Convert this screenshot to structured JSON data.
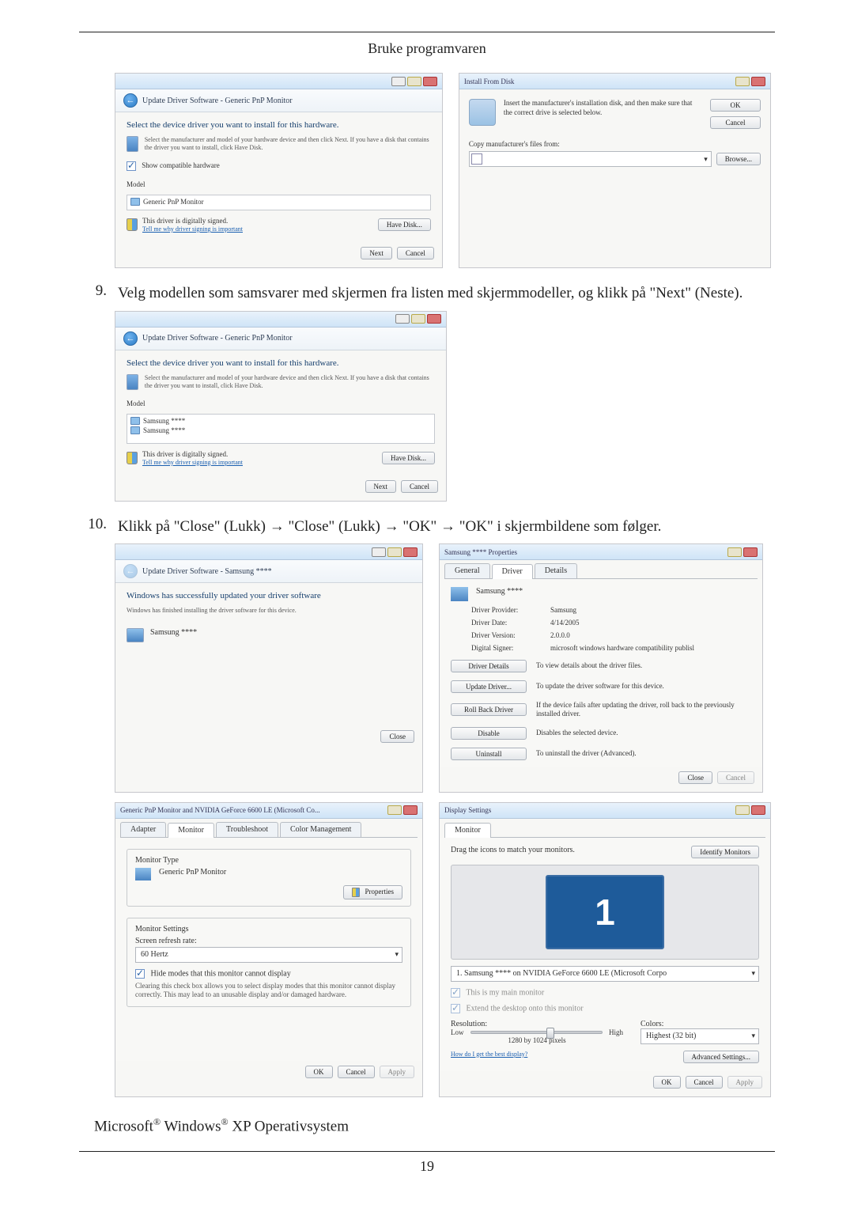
{
  "doc": {
    "running_head": "Bruke programvaren",
    "page_number": "19",
    "os_line_prefix": "Microsoft",
    "os_line_mid": " Windows",
    "os_line_suffix": " XP Operativsystem",
    "reg": "®"
  },
  "steps": {
    "num9": "9.",
    "text9": "Velg modellen som samsvarer med skjermen fra listen med skjermmodeller, og klikk på \"Next\" (Neste).",
    "num10": "10.",
    "text10": "Klikk på \"Close\" (Lukk) → \"Close\" (Lukk) → \"OK\" → \"OK\" i skjermbildene som følger."
  },
  "update_driver": {
    "crumb": "Update Driver Software - Generic PnP Monitor",
    "heading": "Select the device driver you want to install for this hardware.",
    "desc": "Select the manufacturer and model of your hardware device and then click Next. If you have a disk that contains the driver you want to install, click Have Disk.",
    "compat_check": "Show compatible hardware",
    "list_label": "Model",
    "item1": "Generic PnP Monitor",
    "sign_line": "This driver is digitally signed.",
    "sign_link": "Tell me why driver signing is important",
    "have_disk": "Have Disk...",
    "next": "Next",
    "cancel": "Cancel"
  },
  "install_from_disk": {
    "title": "Install From Disk",
    "text": "Insert the manufacturer's installation disk, and then make sure that the correct drive is selected below.",
    "ok": "OK",
    "cancel": "Cancel",
    "copy_label": "Copy manufacturer's files from:",
    "dropdown_caret": "▾",
    "browse": "Browse..."
  },
  "update_driver2": {
    "crumb": "Update Driver Software - Generic PnP Monitor",
    "item_a": "Samsung ****",
    "item_b": "Samsung ****"
  },
  "update_success": {
    "crumb": "Update Driver Software - Samsung ****",
    "heading": "Windows has successfully updated your driver software",
    "subhead": "Windows has finished installing the driver software for this device.",
    "model": "Samsung ****",
    "close": "Close"
  },
  "driver_props": {
    "title": "Samsung **** Properties",
    "tab_general": "General",
    "tab_driver": "Driver",
    "tab_details": "Details",
    "model": "Samsung ****",
    "provider_lbl": "Driver Provider:",
    "provider_val": "Samsung",
    "date_lbl": "Driver Date:",
    "date_val": "4/14/2005",
    "version_lbl": "Driver Version:",
    "version_val": "2.0.0.0",
    "signer_lbl": "Digital Signer:",
    "signer_val": "microsoft windows hardware compatibility publisl",
    "btn_details": "Driver Details",
    "btn_details_desc": "To view details about the driver files.",
    "btn_update": "Update Driver...",
    "btn_update_desc": "To update the driver software for this device.",
    "btn_rollback": "Roll Back Driver",
    "btn_rollback_desc": "If the device fails after updating the driver, roll back to the previously installed driver.",
    "btn_disable": "Disable",
    "btn_disable_desc": "Disables the selected device.",
    "btn_uninstall": "Uninstall",
    "btn_uninstall_desc": "To uninstall the driver (Advanced).",
    "close": "Close",
    "cancel": "Cancel"
  },
  "monitor_adapter": {
    "title": "Generic PnP Monitor and NVIDIA GeForce 6600 LE (Microsoft Co...",
    "tab_adapter": "Adapter",
    "tab_monitor": "Monitor",
    "tab_ts": "Troubleshoot",
    "tab_cm": "Color Management",
    "type_label": "Monitor Type",
    "type_value": "Generic PnP Monitor",
    "properties": "Properties",
    "settings_label": "Monitor Settings",
    "refresh_label": "Screen refresh rate:",
    "refresh_value": "60 Hertz",
    "hide_modes": "Hide modes that this monitor cannot display",
    "hide_modes_desc": "Clearing this check box allows you to select display modes that this monitor cannot display correctly. This may lead to an unusable display and/or damaged hardware.",
    "ok": "OK",
    "cancel": "Cancel",
    "apply": "Apply"
  },
  "display_settings": {
    "title": "Display Settings",
    "tab_monitor": "Monitor",
    "drag_text": "Drag the icons to match your monitors.",
    "identify": "Identify Monitors",
    "monitor_number": "1",
    "monitor_select": "1. Samsung **** on NVIDIA GeForce 6600 LE (Microsoft Corpo",
    "main_monitor": "This is my main monitor",
    "extend": "Extend the desktop onto this monitor",
    "resolution_lbl": "Resolution:",
    "res_low": "Low",
    "res_high": "High",
    "res_value": "1280 by 1024 pixels",
    "colors_lbl": "Colors:",
    "colors_value": "Highest (32 bit)",
    "best_display": "How do I get the best display?",
    "advanced": "Advanced Settings...",
    "ok": "OK",
    "cancel": "Cancel",
    "apply": "Apply"
  }
}
